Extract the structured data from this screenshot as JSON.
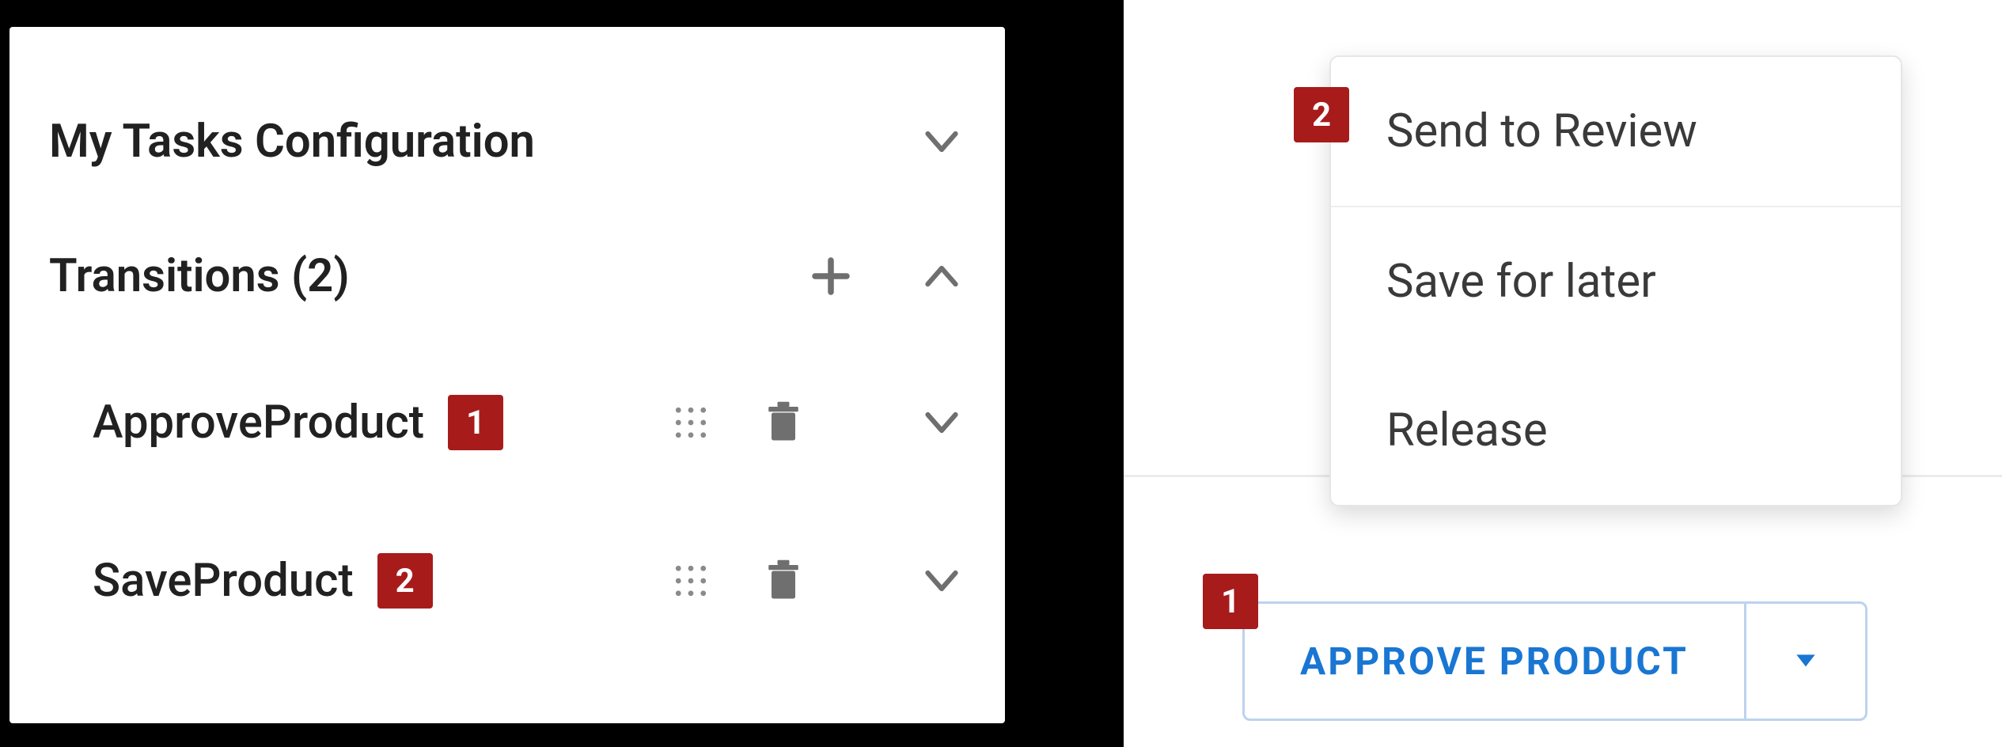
{
  "colors": {
    "badge": "#a81b1b",
    "primary": "#1976d2",
    "icon_grey": "#6f6f6f"
  },
  "panel": {
    "section1_title": "My Tasks Configuration",
    "section2_title": "Transitions (2)",
    "items": [
      {
        "name": "ApproveProduct",
        "badge": "1"
      },
      {
        "name": "SaveProduct",
        "badge": "2"
      }
    ]
  },
  "menu": {
    "items": [
      "Send to Review",
      "Save for later",
      "Release"
    ],
    "badge_top": "2"
  },
  "button": {
    "label": "APPROVE PRODUCT",
    "badge": "1"
  }
}
